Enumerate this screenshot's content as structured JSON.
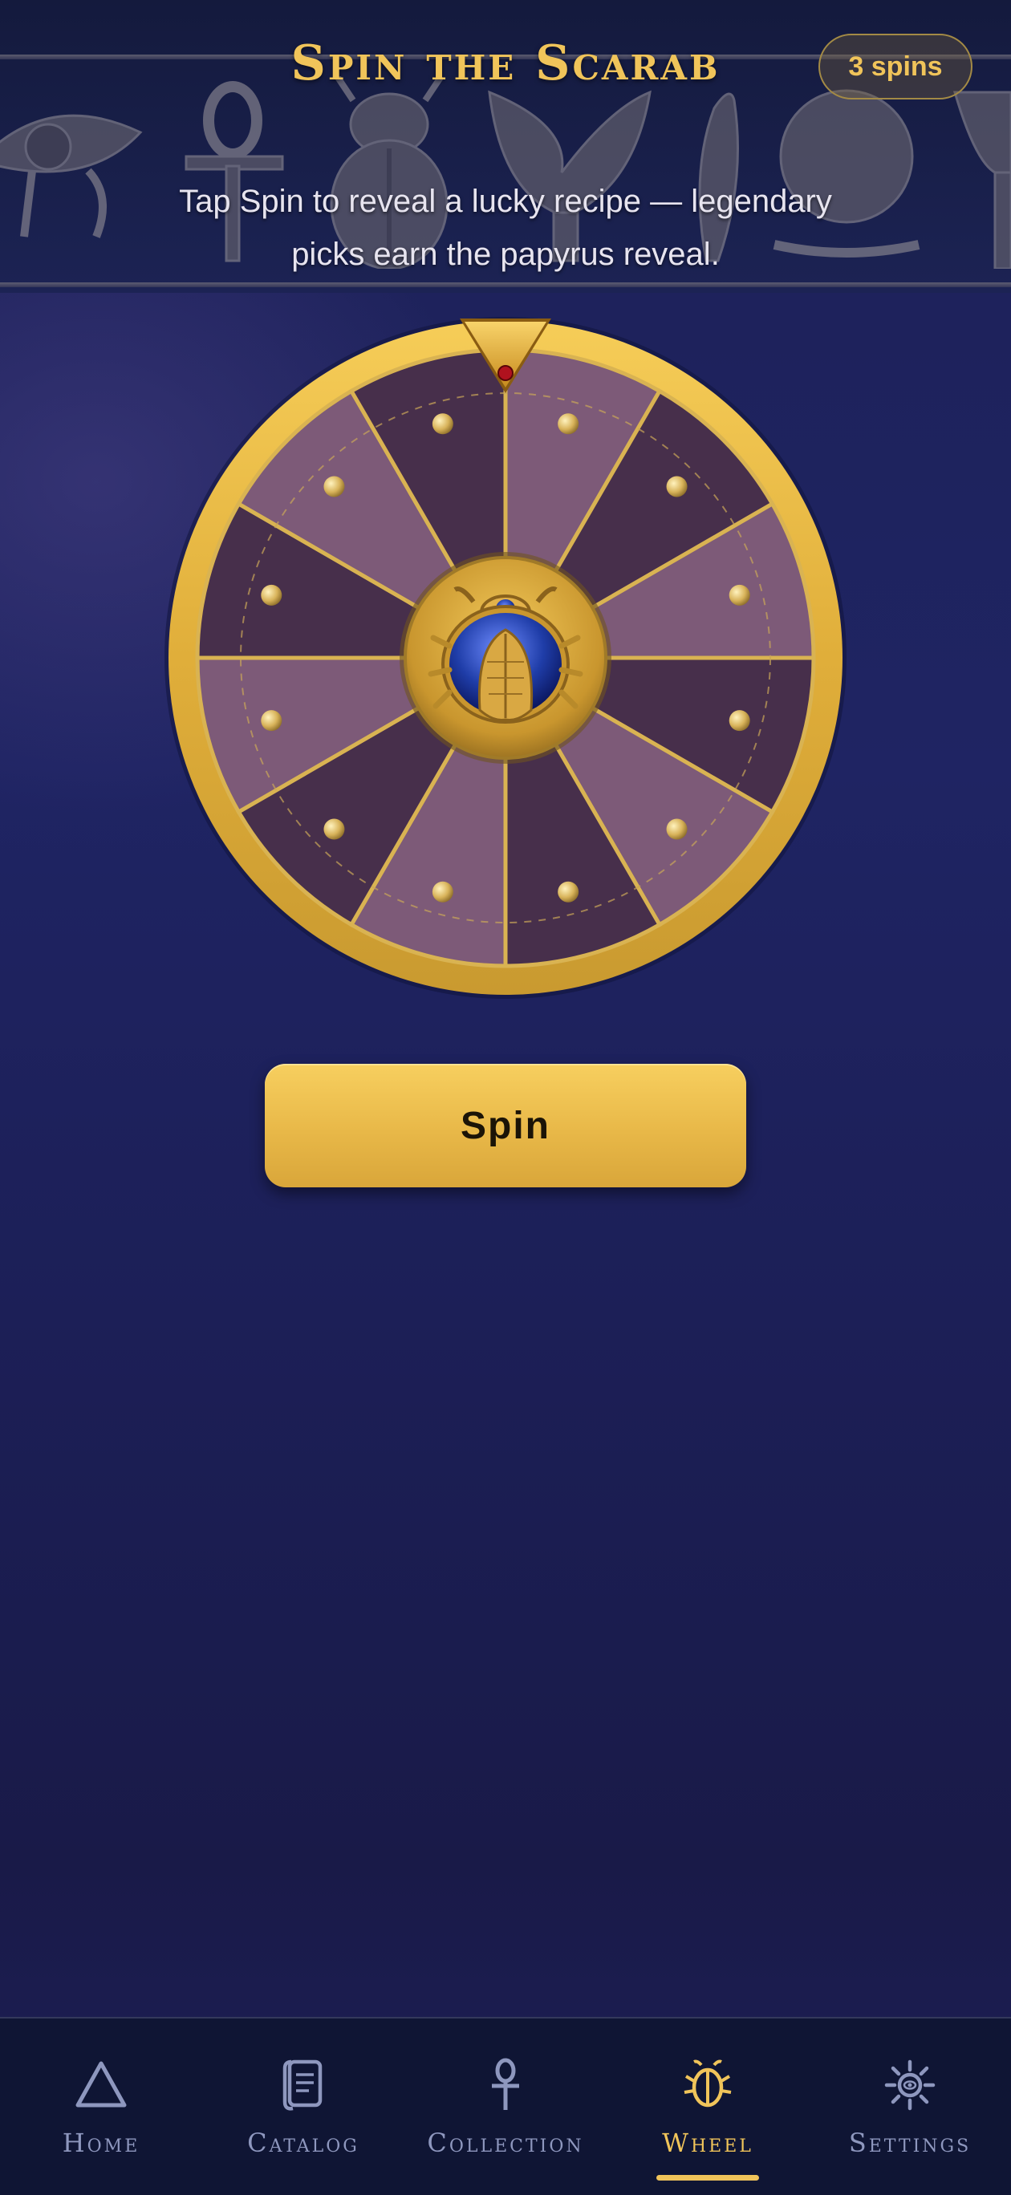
{
  "header": {
    "title": "Spin the Scarab",
    "spins_badge": "3 spins",
    "subtitle_line1": "Tap Spin to reveal a lucky recipe — legendary",
    "subtitle_line2": "picks earn the papyrus reveal."
  },
  "wheel": {
    "segments": 12,
    "segment_colors": [
      "#7d5a78",
      "#472f4b"
    ],
    "center_icon": "scarab-icon",
    "pointer_icon": "pointer-triangle-icon"
  },
  "actions": {
    "spin_label": "Spin"
  },
  "nav": {
    "items": [
      {
        "label": "Home",
        "icon": "pyramid-icon",
        "active": false
      },
      {
        "label": "Catalog",
        "icon": "scroll-icon",
        "active": false
      },
      {
        "label": "Collection",
        "icon": "ankh-icon",
        "active": false
      },
      {
        "label": "Wheel",
        "icon": "scarab-icon",
        "active": true
      },
      {
        "label": "Settings",
        "icon": "sun-gear-icon",
        "active": false
      }
    ]
  },
  "colors": {
    "accent_gold": "#f0c45a",
    "background": "#1d2157",
    "nav_inactive": "#8e97be"
  }
}
